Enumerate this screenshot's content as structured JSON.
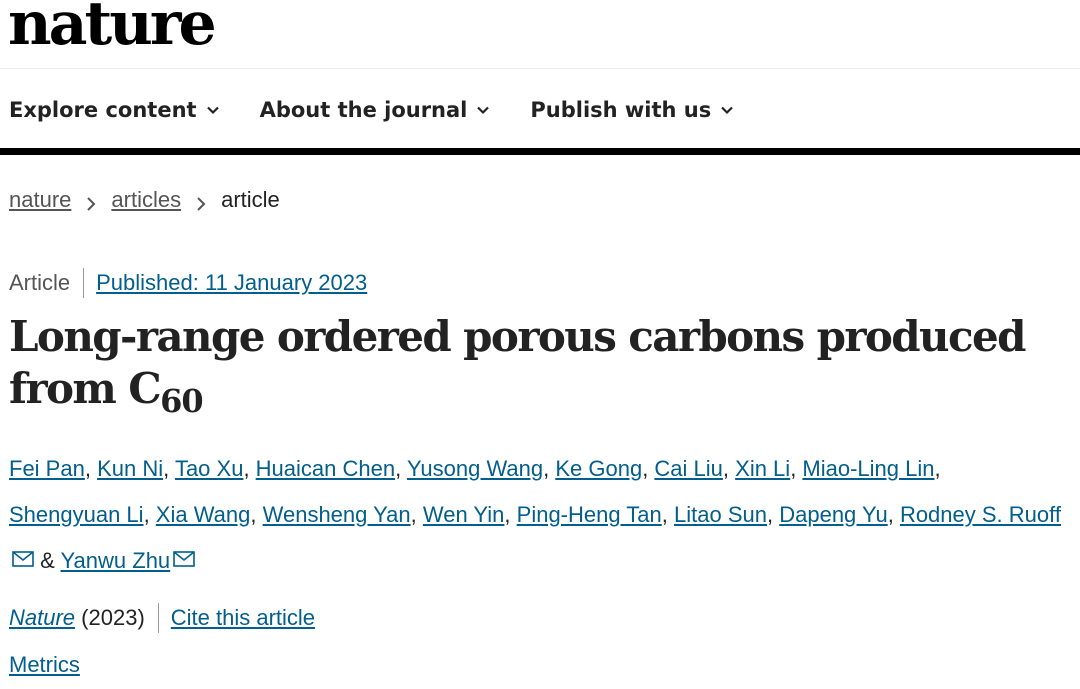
{
  "site": {
    "logo": "nature"
  },
  "nav": [
    {
      "label": "Explore content"
    },
    {
      "label": "About the journal"
    },
    {
      "label": "Publish with us"
    }
  ],
  "breadcrumb": {
    "items": [
      "nature",
      "articles"
    ],
    "current": "article"
  },
  "article": {
    "type": "Article",
    "published": "Published: 11 January 2023",
    "title_main": "Long-range ordered porous carbons produced from C",
    "title_sub": "60",
    "authors": [
      "Fei Pan",
      "Kun Ni",
      "Tao Xu",
      "Huaican Chen",
      "Yusong Wang",
      "Ke Gong",
      "Cai Liu",
      "Xin Li",
      "Miao-Ling Lin",
      "Shengyuan Li",
      "Xia Wang",
      "Wensheng Yan",
      "Wen Yin",
      "Ping-Heng Tan",
      "Litao Sun",
      "Dapeng Yu",
      "Rodney S. Ruoff",
      "Yanwu Zhu"
    ],
    "separator": ",",
    "ampersand": "&",
    "journal_name": "Nature",
    "year": "(2023)",
    "cite": "Cite this article",
    "metrics": "Metrics"
  },
  "icons": {
    "chevron": "chevron-down-icon",
    "separator": "chevron-right-icon",
    "mail": "envelope-icon"
  },
  "colors": {
    "link": "#025e8d",
    "text": "#222222",
    "muted": "#555555",
    "rule": "#000000"
  }
}
